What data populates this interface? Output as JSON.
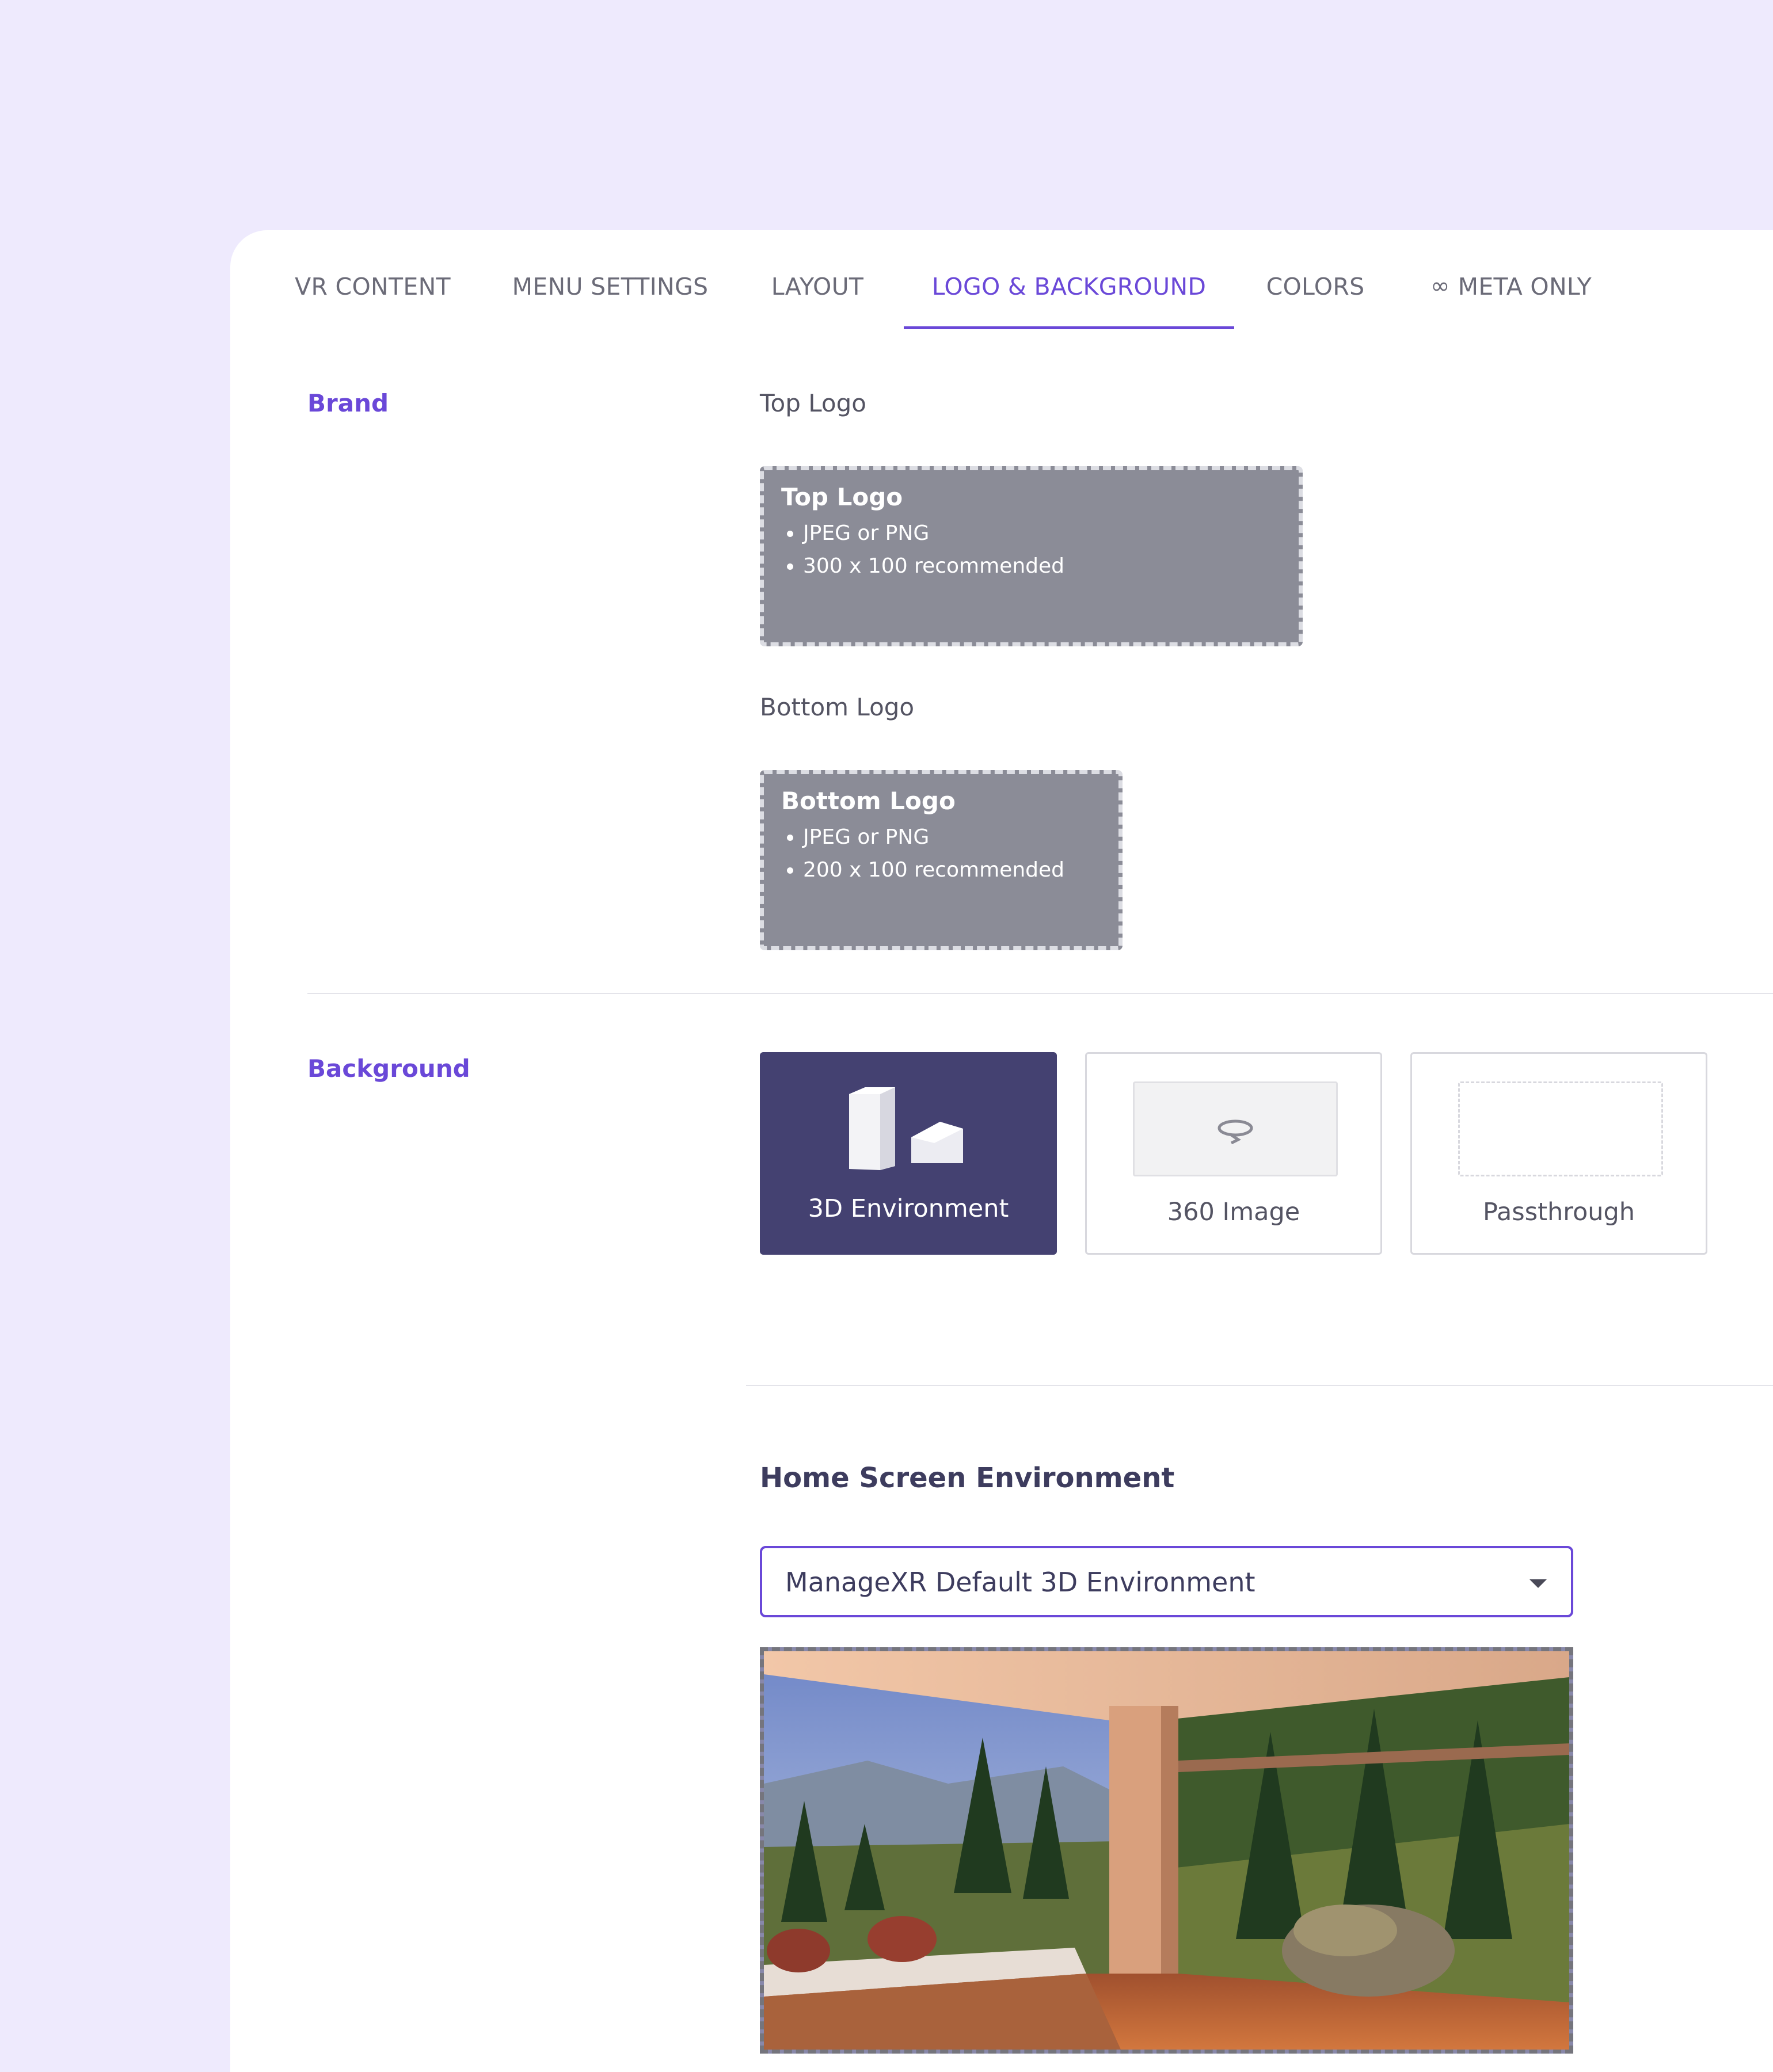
{
  "tabs": {
    "vr_content": "VR CONTENT",
    "menu_settings": "MENU SETTINGS",
    "layout": "LAYOUT",
    "logo_background": "LOGO & BACKGROUND",
    "colors": "COLORS",
    "meta_only": "META ONLY",
    "active": "logo_background"
  },
  "brand": {
    "section_label": "Brand",
    "top_logo": {
      "label": "Top Logo",
      "drop_title": "Top Logo",
      "bullets": [
        "JPEG or PNG",
        "300 x 100 recommended"
      ]
    },
    "bottom_logo": {
      "label": "Bottom Logo",
      "drop_title": "Bottom Logo",
      "bullets": [
        "JPEG or PNG",
        "200 x 100 recommended"
      ]
    }
  },
  "background": {
    "section_label": "Background",
    "options": [
      "3D Environment",
      "360 Image",
      "Passthrough"
    ],
    "selected": "3D Environment"
  },
  "home_screen": {
    "heading": "Home Screen Environment",
    "selected_value": "ManageXR Default 3D Environment"
  },
  "colors": {
    "accent": "#6a48d8",
    "selected_option": "#444171",
    "page_background": "#eeeafd",
    "drop_zone": "#8b8c97"
  },
  "icons": [
    "meta-infinity-icon",
    "3d-shapes-icon",
    "360-rotate-icon",
    "dropdown-caret-icon"
  ]
}
